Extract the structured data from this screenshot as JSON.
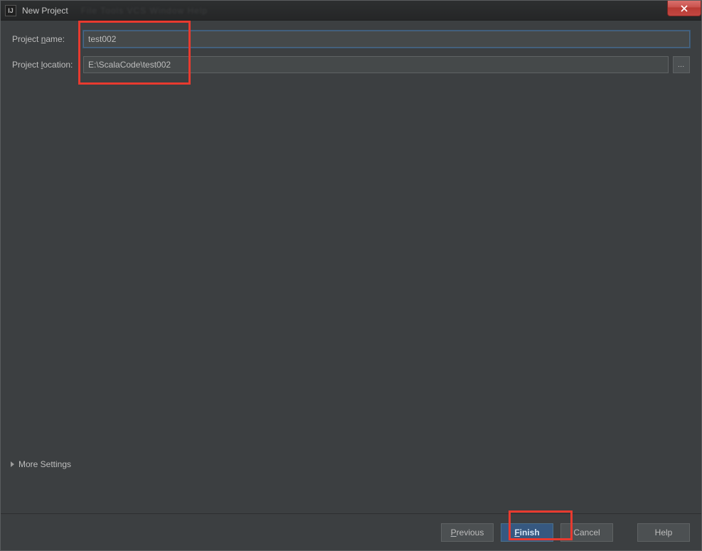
{
  "window": {
    "title": "New Project",
    "blurred_menu": "File  Tools  VCS  Window  Help"
  },
  "form": {
    "project_name_label_pre": "Project ",
    "project_name_label_u": "n",
    "project_name_label_post": "ame:",
    "project_name_value": "test002",
    "project_location_label_pre": "Project ",
    "project_location_label_u": "l",
    "project_location_label_post": "ocation:",
    "project_location_value": "E:\\ScalaCode\\test002",
    "browse_label": "…"
  },
  "more_settings_label": "More Settings",
  "footer": {
    "previous_u": "P",
    "previous_rest": "revious",
    "finish_u": "F",
    "finish_rest": "inish",
    "cancel": "Cancel",
    "help": "Help"
  }
}
